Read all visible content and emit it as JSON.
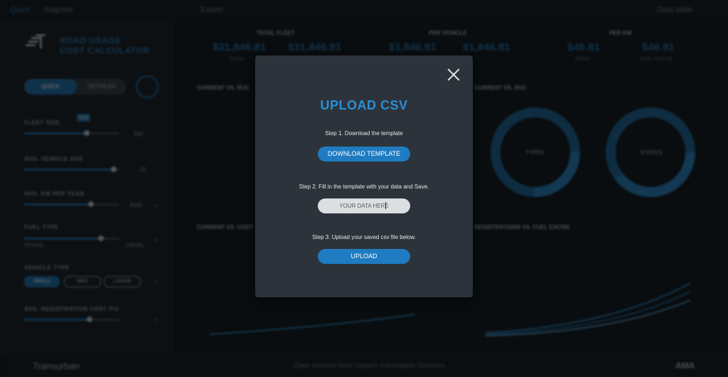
{
  "topbar": {
    "nav_left": "Quick",
    "nav_register": "Register",
    "export": "Export",
    "data_table": "Data table"
  },
  "sidebar": {
    "title_line1": "ROAD USAGE",
    "title_line2": "COST CALCULATOR",
    "toggle_on": "QUICK",
    "toggle_off": "DETAILED",
    "fleet_size": "FLEET SIZE",
    "fleet_badge": "500",
    "fleet_value": "500",
    "vehicle_age": "AVG. VEHICLE AGE",
    "vehicle_age_value": "10",
    "km_per_year": "AVG. KM PER YEAR",
    "km_value": "3000",
    "fuel_type": "FUEL TYPE",
    "fuel_left": "PETROL",
    "fuel_right": "DIESEL",
    "vehicle_type": "VEHICLE TYPE",
    "vt_small": "SMALL",
    "vt_med": "MED",
    "vt_large": "LARGE",
    "reg_cost": "AVG. REGISTRATION COST P/V"
  },
  "kpis": {
    "total_fleet": "TOTAL FLEET",
    "per_vehicle": "PER VEHICLE",
    "per_km": "PER KM",
    "v1": "$31,846.81",
    "v2": "$31,846.81",
    "v3": "$1,846.81",
    "v4": "$1,846.81",
    "v5": "$46.81",
    "v6": "$46.81",
    "s_rego": "REGO",
    "s_excise": "FUEL EXCISE"
  },
  "sections": {
    "current_vs_ruc": "CURRENT VS. RUC",
    "current_vs_ruc2": "CURRENT VS. RUC",
    "current_vs_cost": "CURRENT VS. COST",
    "reg_vs_excise": "REGISTRATIONS VS. FUEL EXCISE",
    "types": "TYPES",
    "states": "STATES"
  },
  "footer": {
    "brand": "Transurban",
    "source": "Data sourced from Glass's Information Services",
    "right_logo": "AMA"
  },
  "modal": {
    "title": "UPLOAD CSV",
    "step1": "Step 1. Download the template",
    "download_button": "DOWNLOAD TEMPLATE",
    "step2": "Step 2. Fill in the template with your data and Save.",
    "input_placeholder": "YOUR DATA HERE",
    "step3": "Step 3. Upload your saved csv file below.",
    "upload_button": "UPLOAD"
  },
  "colors": {
    "accent": "#1f7cc2",
    "modal_bg": "#2d333a"
  }
}
